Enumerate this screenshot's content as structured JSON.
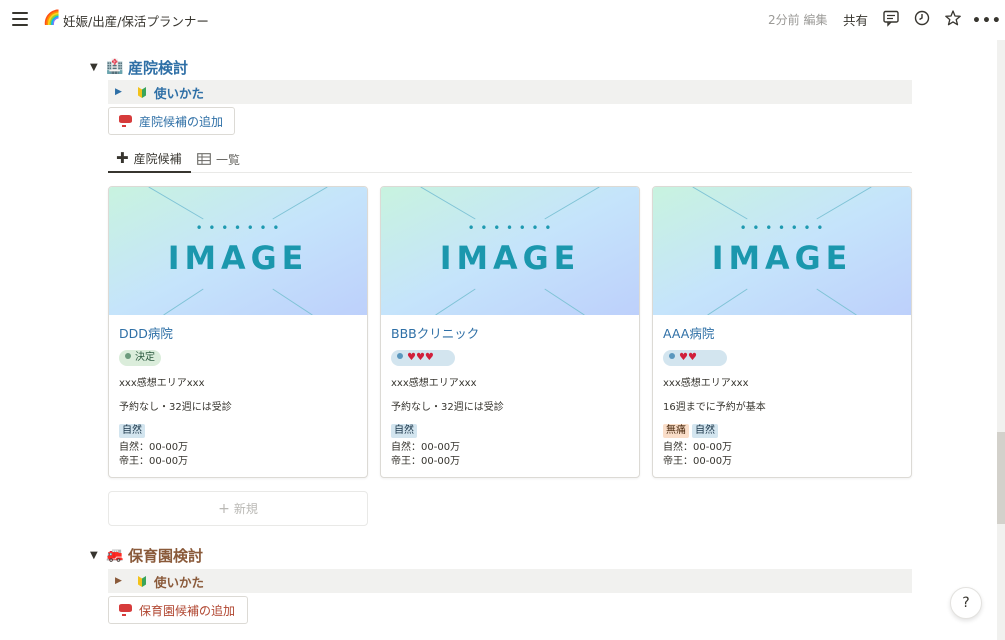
{
  "topbar": {
    "page_emoji": "🌈",
    "breadcrumb": "妊娠/出産/保活プランナー",
    "edited": "2分前 編集",
    "share": "共有",
    "more": "•••"
  },
  "section1": {
    "caret": "▼",
    "emoji": "🏥",
    "title": "産院検討",
    "toggle": {
      "label": "使いかた"
    },
    "add_button": "産院候補の追加",
    "tabs": [
      {
        "label": "産院候補"
      },
      {
        "label": "一覧"
      }
    ],
    "new_label": "新規",
    "cards": [
      {
        "title": "DDD病院",
        "status": "決定",
        "status_style": "green",
        "impression": "xxx感想エリアxxx",
        "note": "予約なし・32週には受診",
        "chips": [
          {
            "label": "自然",
            "style": "blue"
          }
        ],
        "natural": "自然：00-00万",
        "cesarean": "帝王：00-00万"
      },
      {
        "title": "BBBクリニック",
        "status": "♥♥♥",
        "status_style": "blue",
        "impression": "xxx感想エリアxxx",
        "note": "予約なし・32週には受診",
        "chips": [
          {
            "label": "自然",
            "style": "blue"
          }
        ],
        "natural": "自然：00-00万",
        "cesarean": "帝王：00-00万"
      },
      {
        "title": "AAA病院",
        "status": "♥♥",
        "status_style": "blue",
        "impression": "xxx感想エリアxxx",
        "note": "16週までに予約が基本",
        "chips": [
          {
            "label": "無痛",
            "style": "orange"
          },
          {
            "label": "自然",
            "style": "blue"
          }
        ],
        "natural": "自然：00-00万",
        "cesarean": "帝王：00-00万"
      }
    ]
  },
  "section2": {
    "caret": "▼",
    "emoji": "🚒",
    "title": "保育園検討",
    "toggle": {
      "label": "使いかた"
    },
    "add_button": "保育園候補の追加"
  },
  "help": "?",
  "colors": {
    "accent_blue": "#2e6fa6",
    "accent_brown": "#8a5a3a",
    "heart_red": "#d1203b"
  }
}
